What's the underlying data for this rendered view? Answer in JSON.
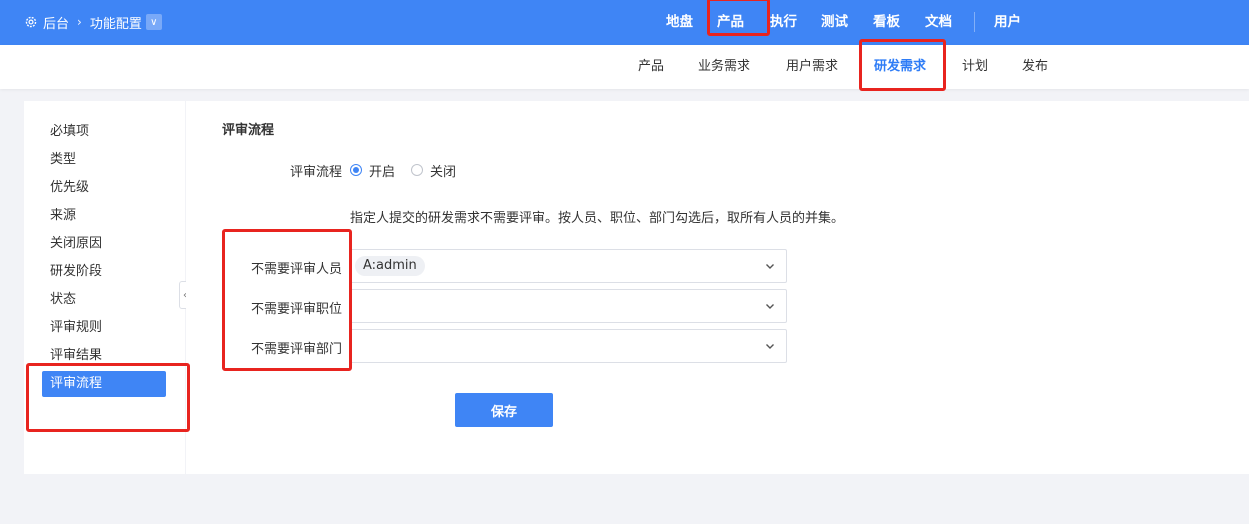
{
  "topbar": {
    "breadcrumb": {
      "home": "后台",
      "current": "功能配置"
    },
    "nav": [
      "地盘",
      "产品",
      "执行",
      "测试",
      "看板",
      "文档",
      "用户"
    ]
  },
  "subnav": {
    "items": [
      "产品",
      "业务需求",
      "用户需求",
      "研发需求",
      "计划",
      "发布"
    ],
    "active": "研发需求"
  },
  "sidebar": {
    "items": [
      "必填项",
      "类型",
      "优先级",
      "来源",
      "关闭原因",
      "研发阶段",
      "状态",
      "评审规则",
      "评审结果",
      "评审流程"
    ],
    "active": "评审流程"
  },
  "main": {
    "section_title": "评审流程",
    "review_flow": {
      "label": "评审流程",
      "options": [
        "开启",
        "关闭"
      ],
      "selected": "开启"
    },
    "hint": "指定人提交的研发需求不需要评审。按人员、职位、部门勾选后，取所有人员的并集。",
    "fields": [
      {
        "label": "不需要评审人员",
        "tags": [
          "A:admin"
        ]
      },
      {
        "label": "不需要评审职位",
        "tags": []
      },
      {
        "label": "不需要评审部门",
        "tags": []
      }
    ],
    "save_label": "保存"
  },
  "colors": {
    "primary": "#3f85f5",
    "annotation": "#e8241f"
  }
}
